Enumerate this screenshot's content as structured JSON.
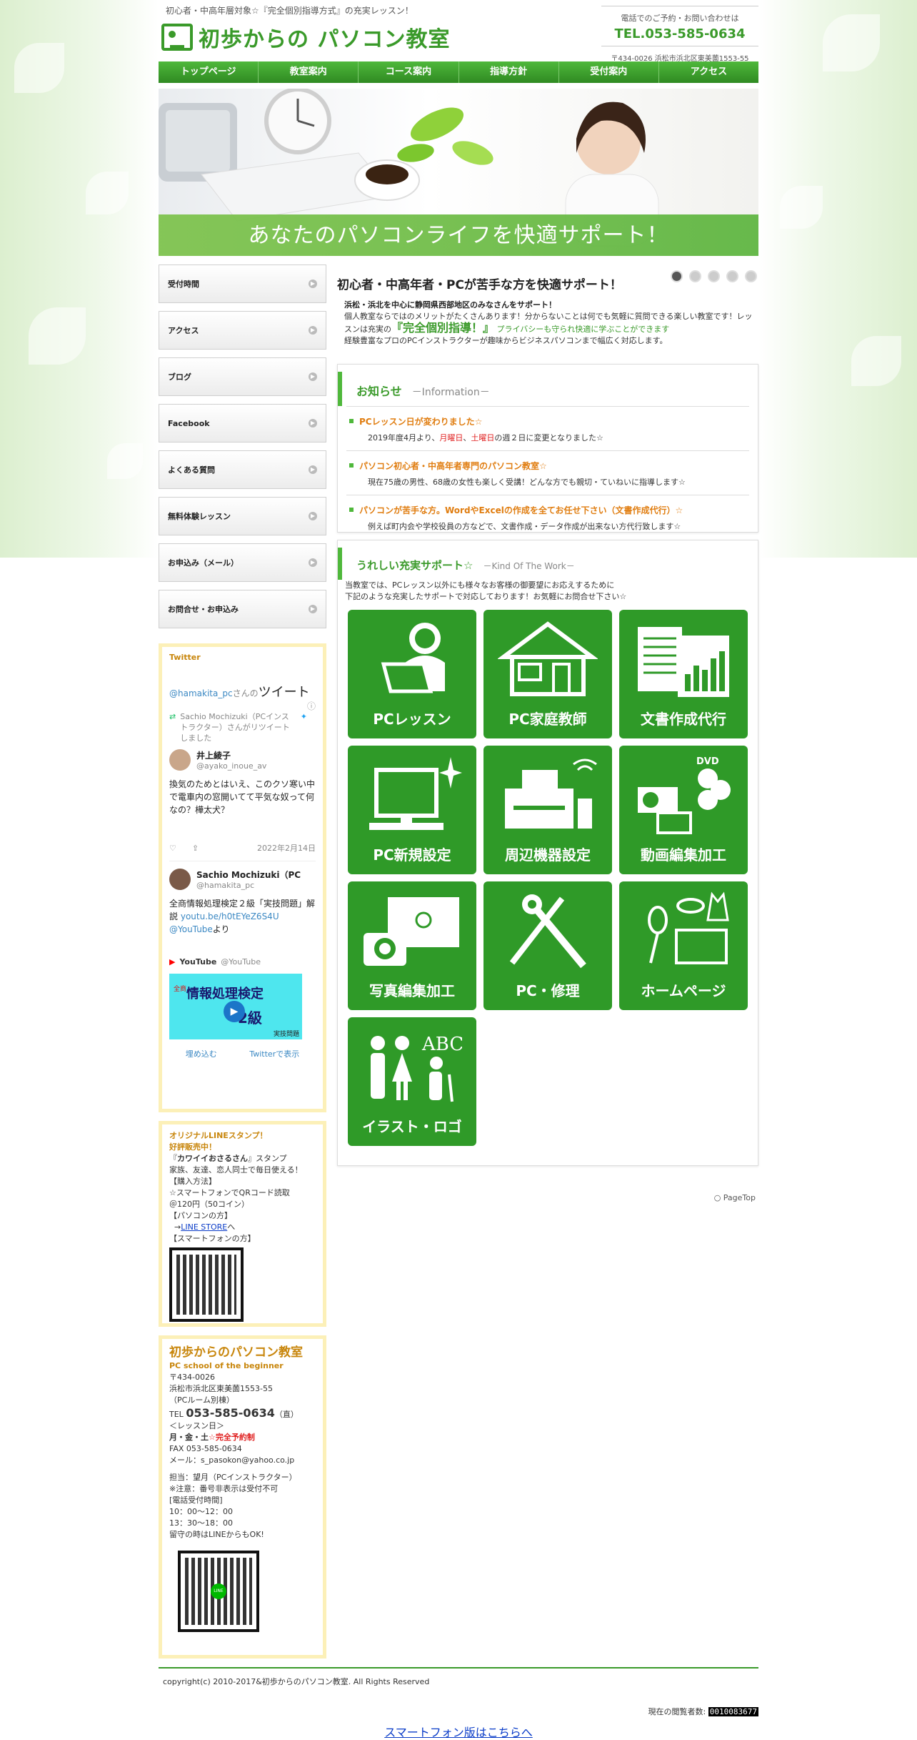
{
  "header": {
    "tagline": "初心者・中高年層対象☆『完全個別指導方式』の充実レッスン！",
    "logo_text": "初歩からの パソコン教室",
    "contact_label": "電話でのご予約・お問い合わせは",
    "tel": "TEL.053-585-0634",
    "address": "〒434-0026 浜松市浜北区東美薗1553-55"
  },
  "nav": [
    "トップページ",
    "教室案内",
    "コース案内",
    "指導方針",
    "受付案内",
    "アクセス"
  ],
  "hero": {
    "caption": "あなたのパソコンライフを快適サポート！"
  },
  "sidebar": {
    "items": [
      "受付時間",
      "アクセス",
      "ブログ",
      "Facebook",
      "よくある質問",
      "無料体験レッスン",
      "お申込み（メール）",
      "お問合せ・お申込み"
    ]
  },
  "twitter": {
    "title": "Twitter",
    "handle_line_handle": "@hamakita_pc",
    "handle_line_suffix": "さんの",
    "handle_line_tweet": "ツイート",
    "retweet_note": "Sachio Mochizuki（PCインストラクター）さんがリツイートしました",
    "t1_name": "井上綾子",
    "t1_handle": "@ayako_inoue_av",
    "t1_text": "換気のためとはいえ、このクソ寒い中で電車内の窓開いてて平気な奴って何なの？樺太犬？",
    "t1_date": "2022年2月14日",
    "t2_name": "Sachio Mochizuki（PC",
    "t2_handle": "@hamakita_pc",
    "t2_text": "全商情報処理検定２級「実技問題」解説",
    "t2_link": "youtu.be/h0tEYeZ6S4U",
    "t2_link2": "@YouTube",
    "t2_suffix": "より",
    "yt_name": "YouTube",
    "yt_handle": "@YouTube",
    "thumb_text": "情報処理検定",
    "thumb_sub": "2級",
    "thumb_small": "全商",
    "thumb_corner": "実技問題",
    "embed": "埋め込む",
    "view": "Twitterで表示"
  },
  "line_box": {
    "title1": "オリジナルLINEスタンプ！",
    "title2": "好評販売中！",
    "l1a": "『",
    "l1b": "カワイイおさるさん",
    "l1c": "』スタンプ",
    "l2": "家族、友達、恋人同士で毎日使える！",
    "l3": "【購入方法】",
    "l4": "☆スマートフォンでQRコード読取",
    "l5": "＠120円（50コイン）",
    "l6": "【パソコンの方】",
    "l7a": "→",
    "l7b": "LINE STORE",
    "l7c": "へ",
    "l8": "【スマートフォンの方】"
  },
  "info_box": {
    "name": "初歩からのパソコン教室",
    "en": "PC school of the beginner",
    "zip": "〒434-0026",
    "addr": "浜松市浜北区東美薗1553-55",
    "room": "（PCルーム別棟）",
    "tel_label": "TEL",
    "tel": "053-585-0634",
    "tel_note": "（直）",
    "lesson_label": "＜レッスン日＞",
    "lesson_days": "月・金・土",
    "lesson_note": "☆完全予約制",
    "fax": "FAX 053-585-0634",
    "mail": "メール：s_pasokon@yahoo.co.jp",
    "staff": "担当：望月（PCインストラクター）",
    "caution": "※注意：番号非表示は受付不可",
    "hours_label": "[電話受付時間]",
    "hours1": "10：00～12：00",
    "hours2": "13：30～18：00",
    "absent": "留守の時はLINEからもOK!",
    "qr_label": "LINE"
  },
  "main": {
    "headline": "初心者・中高年者・PCが苦手な方を快適サポート！",
    "intro1": "浜松・浜北を中心に静岡県西部地区のみなさんをサポート！",
    "intro2": "個人教室ならではのメリットがたくさんあります！分からないことは何でも気軽に質問できる楽しい教室です！レッスンは充実の",
    "intro_big": "『完全個別指導！』",
    "intro_green": "プライバシーも守られ快適に学ぶことができます",
    "intro3": "経験豊富なプロのPCインストラクターが趣味からビジネスパソコンまで幅広く対応します。"
  },
  "news": {
    "title": "お知らせ",
    "subtitle": "－Information－",
    "items": [
      {
        "title": "PCレッスン日が変わりました☆",
        "body_a": "2019年度4月より、",
        "body_b": "月曜日",
        "body_c": "、",
        "body_d": "土曜日",
        "body_e": "の週２日に変更となりました☆"
      },
      {
        "title": "パソコン初心者・中高年者専門のパソコン教室☆",
        "body": "現在75歳の男性、68歳の女性も楽しく受講！どんな方でも親切・ていねいに指導します☆"
      },
      {
        "title": "パソコンが苦手な方。WordやExcelの作成を全てお任せ下さい（文書作成代行）☆",
        "body": "例えば町内会や学校役員の方などで、文書作成・データ作成が出来ない方代行致します☆"
      }
    ]
  },
  "services": {
    "title": "うれしい充実サポート☆",
    "subtitle": "－Kind Of The Work－",
    "desc1": "当教室では、PCレッスン以外にも様々なお客様の御要望にお応えするために",
    "desc2": "下記のような充実したサポートで対応しております！お気軽にお問合せ下さい☆",
    "tiles": [
      "PCレッスン",
      "PC家庭教師",
      "文書作成代行",
      "PC新規設定",
      "周辺機器設定",
      "動画編集加工",
      "写真編集加工",
      "PC・修理",
      "ホームページ",
      "イラスト・ロゴ"
    ],
    "dvd": "DVD",
    "abc": "ABC"
  },
  "pagetop": "○ PageTop",
  "footer": {
    "copyright": "copyright(c) 2010-2017&初歩からのパソコン教室. All Rights Reserved",
    "counter_label": "現在の閲覧者数:",
    "counter_value": "0010083677",
    "smartphone": "スマートフォン版はこちらへ"
  },
  "colors": {
    "brand_green": "#3a9a2a",
    "tile_green": "#2f9a28",
    "accent_orange": "#e07d10",
    "alert_red": "#e02020"
  }
}
